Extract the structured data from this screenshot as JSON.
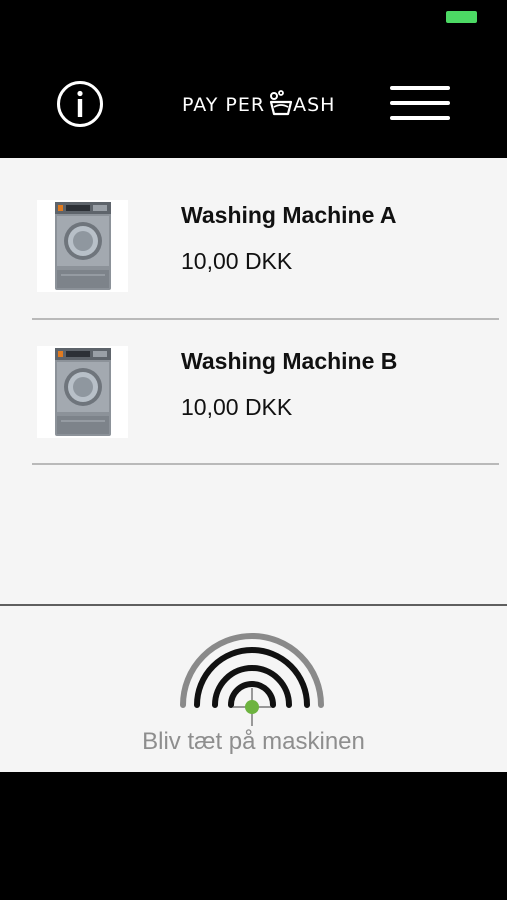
{
  "app": {
    "logo_text_left": "PAY PER",
    "logo_text_right": "ASH"
  },
  "status": {
    "battery_color": "#4cd964"
  },
  "machines": [
    {
      "name": "Washing Machine A",
      "price": "10,00 DKK"
    },
    {
      "name": "Washing Machine B",
      "price": "10,00 DKK"
    }
  ],
  "proximity": {
    "hint": "Bliv tæt på maskinen",
    "dot_color": "#6db33f"
  },
  "icons": {
    "info": "info-icon",
    "menu": "hamburger-menu-icon",
    "logo": "washing-tub-icon",
    "machine": "washing-machine-icon",
    "proximity": "proximity-signal-icon"
  }
}
